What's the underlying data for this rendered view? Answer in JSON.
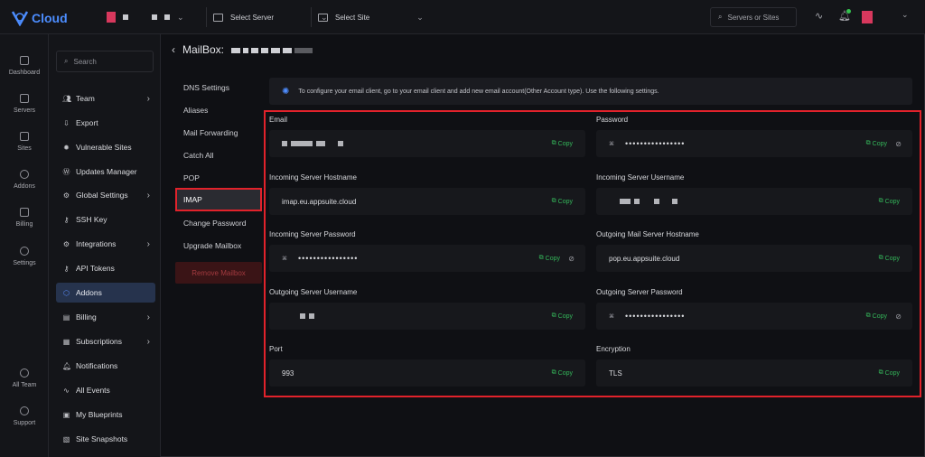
{
  "app": {
    "logo_text": "Cloud"
  },
  "topbar": {
    "select_server": "Select Server",
    "select_site": "Select Site",
    "search_placeholder": "Servers or Sites"
  },
  "rail": [
    {
      "label": "Dashboard"
    },
    {
      "label": "Servers"
    },
    {
      "label": "Sites"
    },
    {
      "label": "Addons"
    },
    {
      "label": "Billing"
    },
    {
      "label": "Settings"
    },
    {
      "label": "All Team"
    },
    {
      "label": "Support"
    }
  ],
  "sidebar": {
    "search_placeholder": "Search",
    "items": [
      {
        "label": "Team"
      },
      {
        "label": "Export"
      },
      {
        "label": "Vulnerable Sites"
      },
      {
        "label": "Updates Manager"
      },
      {
        "label": "Global Settings"
      },
      {
        "label": "SSH Key"
      },
      {
        "label": "Integrations"
      },
      {
        "label": "API Tokens"
      },
      {
        "label": "Addons"
      },
      {
        "label": "Billing"
      },
      {
        "label": "Subscriptions"
      },
      {
        "label": "Notifications"
      },
      {
        "label": "All Events"
      },
      {
        "label": "My Blueprints"
      },
      {
        "label": "Site Snapshots"
      }
    ]
  },
  "page": {
    "title": "MailBox:"
  },
  "mailbox_menu": {
    "items": [
      {
        "label": "DNS Settings"
      },
      {
        "label": "Aliases"
      },
      {
        "label": "Mail Forwarding"
      },
      {
        "label": "Catch All"
      },
      {
        "label": "POP"
      },
      {
        "label": "IMAP"
      },
      {
        "label": "Change Password"
      },
      {
        "label": "Upgrade Mailbox"
      }
    ],
    "remove_label": "Remove Mailbox"
  },
  "info": {
    "text": "To configure your email client, go to your email client and add new email account(Other Account type). Use the following settings."
  },
  "fields": {
    "copy_label": "Copy",
    "email": {
      "label": "Email"
    },
    "password": {
      "label": "Password",
      "value": "••••••••••••••••"
    },
    "in_host": {
      "label": "Incoming Server Hostname",
      "value": "imap.eu.appsuite.cloud"
    },
    "in_user": {
      "label": "Incoming Server Username"
    },
    "in_pass": {
      "label": "Incoming Server Password",
      "value": "••••••••••••••••"
    },
    "out_host": {
      "label": "Outgoing Mail Server Hostname",
      "value": "pop.eu.appsuite.cloud"
    },
    "out_user": {
      "label": "Outgoing Server Username"
    },
    "out_pass": {
      "label": "Outgoing Server Password",
      "value": "••••••••••••••••"
    },
    "port": {
      "label": "Port",
      "value": "993"
    },
    "encryption": {
      "label": "Encryption",
      "value": "TLS"
    }
  },
  "colors": {
    "accent": "#4c8dff",
    "copy": "#34b65a",
    "highlight": "#e1222b"
  }
}
